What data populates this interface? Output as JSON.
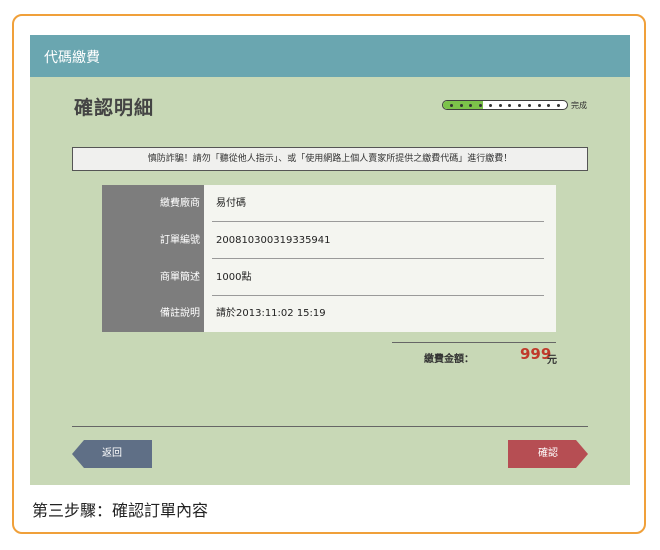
{
  "header": {
    "title": "代碼繳費"
  },
  "page": {
    "title": "確認明細"
  },
  "progress": {
    "fraction": 0.32,
    "label": "完成"
  },
  "warning": {
    "text": "慎防詐騙！請勿「聽從他人指示」、或「使用網路上個人賣家所提供之繳費代碼」進行繳費！"
  },
  "details": {
    "rows": [
      {
        "label": "繳費廠商",
        "value": "易付碼"
      },
      {
        "label": "訂單編號",
        "value": "200810300319335941"
      },
      {
        "label": "商單簡述",
        "value": "1000點"
      },
      {
        "label": "備註說明",
        "value": "請於2013:11:02 15:19"
      }
    ]
  },
  "total": {
    "label": "繳費金額：",
    "amount": "999",
    "unit": "元"
  },
  "buttons": {
    "back": "返回",
    "confirm": "確認"
  },
  "caption": "第三步驟：確認訂單內容",
  "colors": {
    "accent_border": "#f0a03a",
    "header": "#6aa6b0",
    "background": "#c8d8b6",
    "confirm": "#b64e53",
    "back": "#5f6f86",
    "amount": "#c0392b"
  }
}
